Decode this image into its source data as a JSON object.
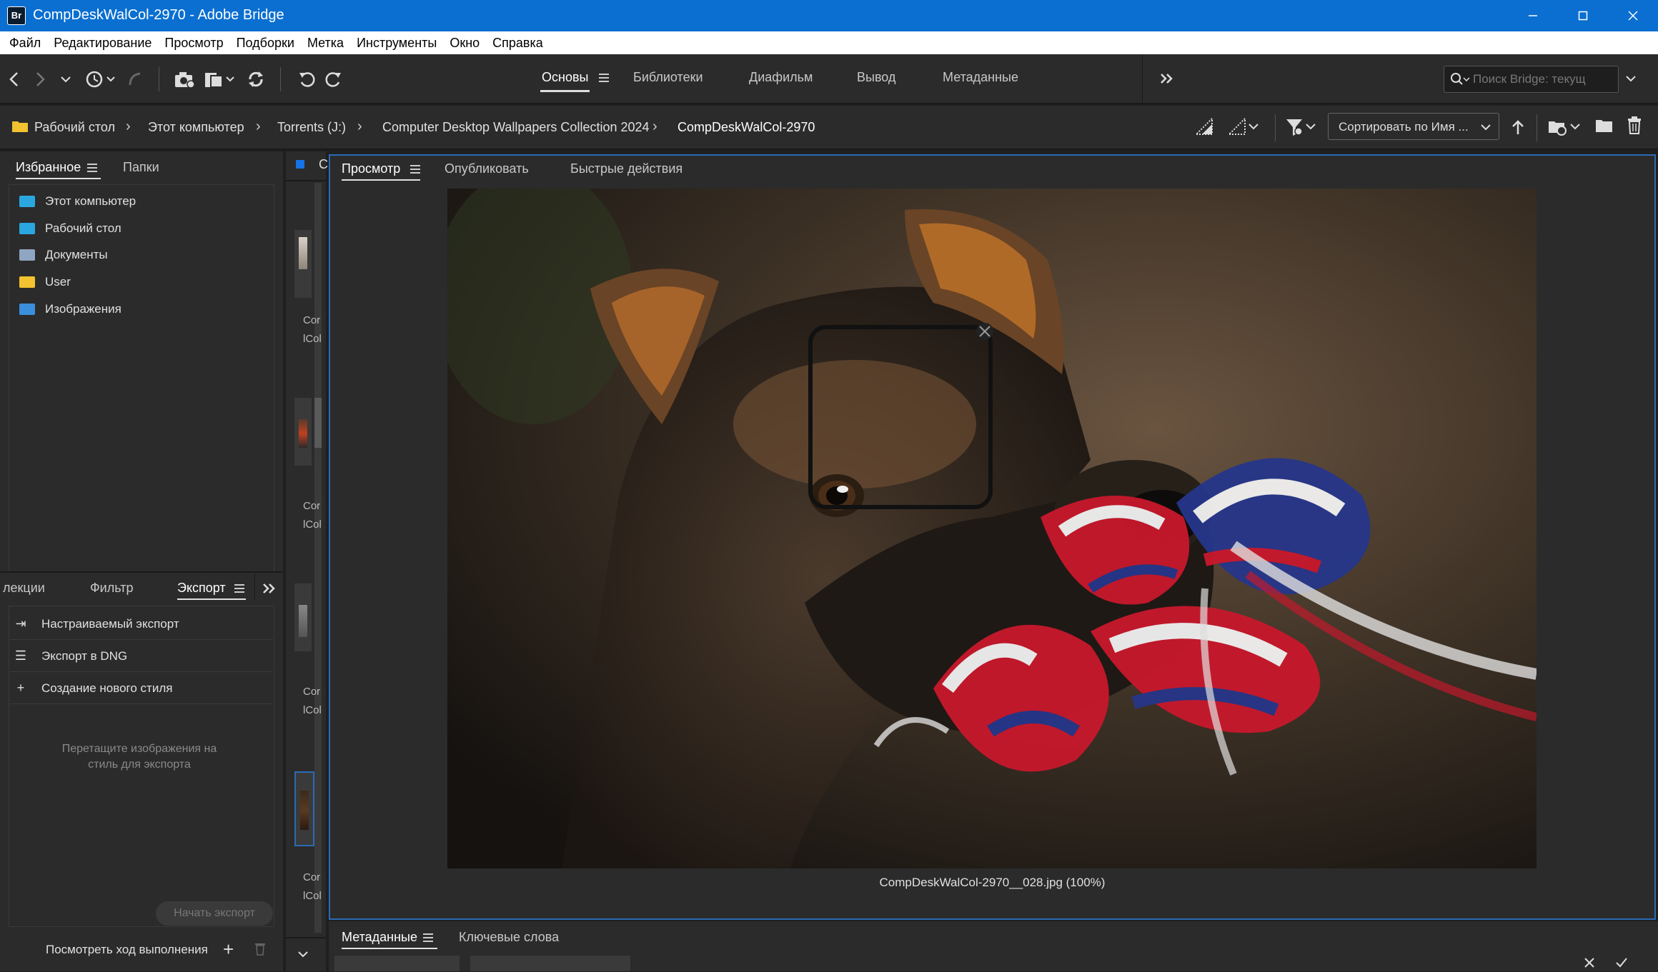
{
  "window": {
    "title": "CompDeskWalCol-2970 - Adobe Bridge",
    "logo": "Br"
  },
  "menu": [
    "Файл",
    "Редактирование",
    "Просмотр",
    "Подборки",
    "Метка",
    "Инструменты",
    "Окно",
    "Справка"
  ],
  "workspaces": [
    "Основы",
    "Библиотеки",
    "Диафильм",
    "Вывод",
    "Метаданные"
  ],
  "search": {
    "placeholder": "Поиск Bridge: текущ"
  },
  "breadcrumb": [
    "Рабочий стол",
    "Этот компьютер",
    "Torrents (J:)",
    "Computer Desktop Wallpapers Collection 2024",
    "CompDeskWalCol-2970"
  ],
  "sort": {
    "label": "Сортировать по Имя ..."
  },
  "left_top": {
    "tabs": [
      "Избранное",
      "Папки"
    ],
    "favorites": [
      {
        "label": "Этот компьютер",
        "color": "#2aa7e0"
      },
      {
        "label": "Рабочий стол",
        "color": "#2aa7e0"
      },
      {
        "label": "Документы",
        "color": "#8fa6c2"
      },
      {
        "label": "User",
        "color": "#f2c230"
      },
      {
        "label": "Изображения",
        "color": "#3b8fdc"
      }
    ]
  },
  "left_bottom": {
    "tabs": [
      "лекции",
      "Фильтр",
      "Экспорт"
    ],
    "items": [
      "Настраиваемый экспорт",
      "Экспорт в DNG",
      "Создание нового стиля"
    ],
    "drop_hint": [
      "Перетащите изображения на",
      "стиль для экспорта"
    ],
    "start_button": "Начать экспорт",
    "progress_link": "Посмотреть ход выполнения"
  },
  "content": {
    "labels": [
      "Cor",
      "lCol"
    ],
    "header_letter": "C"
  },
  "preview": {
    "tabs": [
      "Просмотр",
      "Опубликовать",
      "Быстрые действия"
    ],
    "caption": "CompDeskWalCol-2970__028.jpg (100%)"
  },
  "bottom": {
    "tabs": [
      "Метаданные",
      "Ключевые слова"
    ]
  }
}
